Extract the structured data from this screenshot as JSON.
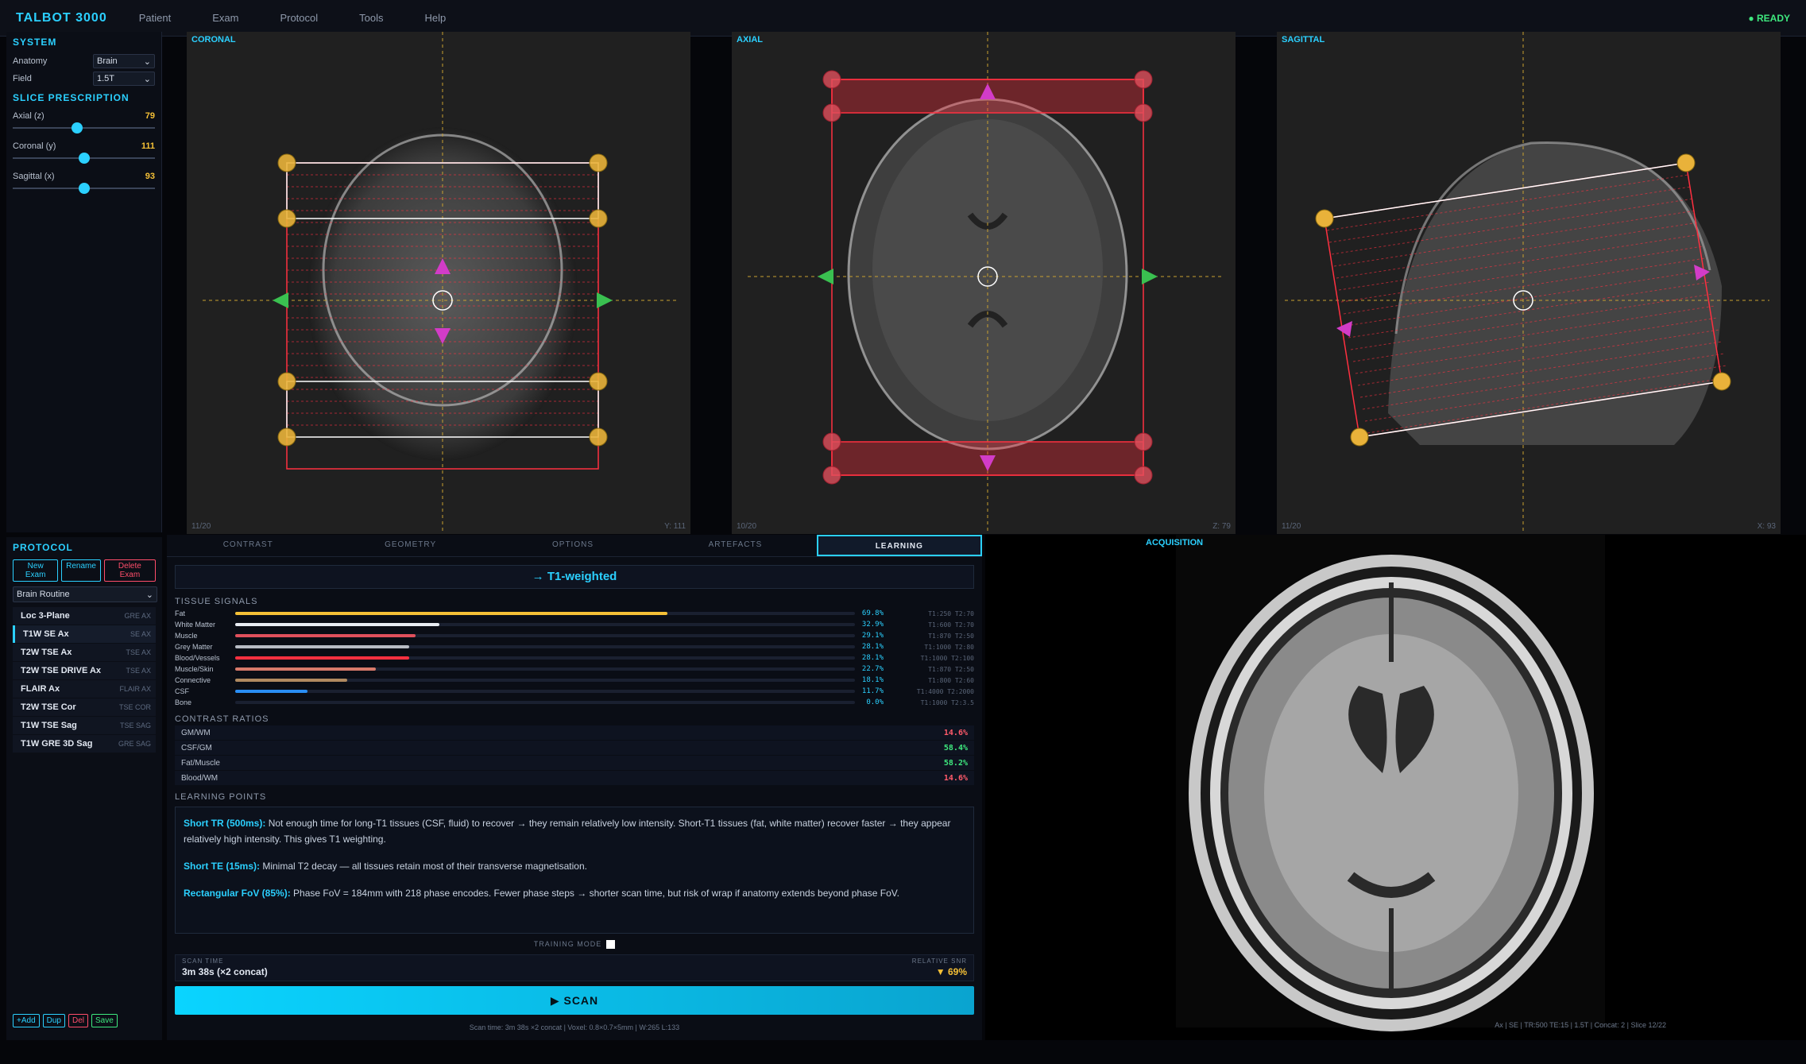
{
  "app": {
    "title": "TALBOT 3000",
    "status": "● READY"
  },
  "menu": [
    "Patient",
    "Exam",
    "Protocol",
    "Tools",
    "Help"
  ],
  "system": {
    "title": "SYSTEM",
    "anatomy_label": "Anatomy",
    "anatomy_value": "Brain",
    "field_label": "Field",
    "field_value": "1.5T"
  },
  "slice": {
    "title": "SLICE PRESCRIPTION",
    "axial_label": "Axial (z)",
    "axial_value": "79",
    "axial_frac": 0.45,
    "coronal_label": "Coronal (y)",
    "coronal_value": "111",
    "coronal_frac": 0.5,
    "sagittal_label": "Sagittal (x)",
    "sagittal_value": "93",
    "sagittal_frac": 0.5
  },
  "viewports": {
    "coronal": {
      "label": "CORONAL",
      "foot_left": "11/20",
      "foot_right": "Y: 111"
    },
    "axial": {
      "label": "AXIAL",
      "foot_left": "10/20",
      "foot_right": "Z: 79"
    },
    "sagittal": {
      "label": "SAGITTAL",
      "foot_left": "11/20",
      "foot_right": "X: 93"
    }
  },
  "protocol": {
    "title": "PROTOCOL",
    "new_exam": "New Exam",
    "rename": "Rename",
    "delete_exam": "Delete Exam",
    "routine": "Brain Routine",
    "items": [
      {
        "name": "Loc 3-Plane",
        "type": "GRE AX"
      },
      {
        "name": "T1W SE Ax",
        "type": "SE AX"
      },
      {
        "name": "T2W TSE Ax",
        "type": "TSE AX"
      },
      {
        "name": "T2W TSE DRIVE Ax",
        "type": "TSE AX"
      },
      {
        "name": "FLAIR Ax",
        "type": "FLAIR AX"
      },
      {
        "name": "T2W TSE Cor",
        "type": "TSE COR"
      },
      {
        "name": "T1W TSE Sag",
        "type": "TSE SAG"
      },
      {
        "name": "T1W GRE 3D Sag",
        "type": "GRE SAG"
      }
    ],
    "add": "+Add",
    "dup": "Dup",
    "del": "Del",
    "save": "Save"
  },
  "tabs": [
    "CONTRAST",
    "GEOMETRY",
    "OPTIONS",
    "ARTEFACTS",
    "LEARNING"
  ],
  "learning": {
    "weighting": "→ T1-weighted",
    "tissue_title": "TISSUE SIGNALS",
    "tissues": [
      {
        "name": "Fat",
        "pct": "69.8%",
        "frac": 0.698,
        "color": "#f5c036",
        "t": "T1:250 T2:70"
      },
      {
        "name": "White Matter",
        "pct": "32.9%",
        "frac": 0.329,
        "color": "#e8ecf2",
        "t": "T1:600 T2:70"
      },
      {
        "name": "Muscle",
        "pct": "29.1%",
        "frac": 0.291,
        "color": "#e0505c",
        "t": "T1:870 T2:50"
      },
      {
        "name": "Grey Matter",
        "pct": "28.1%",
        "frac": 0.281,
        "color": "#b8bcc4",
        "t": "T1:1000 T2:80"
      },
      {
        "name": "Blood/Vessels",
        "pct": "28.1%",
        "frac": 0.281,
        "color": "#ff3040",
        "t": "T1:1000 T2:100"
      },
      {
        "name": "Muscle/Skin",
        "pct": "22.7%",
        "frac": 0.227,
        "color": "#d87a6a",
        "t": "T1:870 T2:50"
      },
      {
        "name": "Connective",
        "pct": "18.1%",
        "frac": 0.181,
        "color": "#b08a60",
        "t": "T1:800 T2:60"
      },
      {
        "name": "CSF",
        "pct": "11.7%",
        "frac": 0.117,
        "color": "#2a8ef5",
        "t": "T1:4000 T2:2000"
      },
      {
        "name": "Bone",
        "pct": "0.0%",
        "frac": 0.0,
        "color": "#606878",
        "t": "T1:1000 T2:3.5"
      }
    ],
    "ratios_title": "CONTRAST RATIOS",
    "ratios": [
      {
        "name": "GM/WM",
        "value": "14.6%",
        "color": "#ff5a6a"
      },
      {
        "name": "CSF/GM",
        "value": "58.4%",
        "color": "#3ee87e"
      },
      {
        "name": "Fat/Muscle",
        "value": "58.2%",
        "color": "#3ee87e"
      },
      {
        "name": "Blood/WM",
        "value": "14.6%",
        "color": "#ff5a6a"
      }
    ],
    "points_title": "LEARNING POINTS",
    "points": [
      {
        "head": "Short TR (500ms):",
        "body": " Not enough time for long-T1 tissues (CSF, fluid) to recover → they remain relatively low intensity. Short-T1 tissues (fat, white matter) recover faster → they appear relatively high intensity. This gives T1 weighting."
      },
      {
        "head": "Short TE (15ms):",
        "body": " Minimal T2 decay — all tissues retain most of their transverse magnetisation."
      },
      {
        "head": "Rectangular FoV (85%):",
        "body": " Phase FoV = 184mm with 218 phase encodes. Fewer phase steps → shorter scan time, but risk of wrap if anatomy extends beyond phase FoV."
      }
    ]
  },
  "scan": {
    "training_mode": "TRAINING MODE",
    "time_label": "SCAN TIME",
    "time_value": "3m 38s (×2 concat)",
    "snr_label": "RELATIVE SNR",
    "snr_value": "▼ 69%",
    "button": "▶ SCAN",
    "footer": "Scan time: 3m 38s ×2 concat | Voxel: 0.8×0.7×5mm | W:265 L:133"
  },
  "acquisition": {
    "label": "ACQUISITION",
    "footer": "Ax | SE | TR:500 TE:15 | 1.5T | Concat: 2 | Slice 12/22"
  },
  "colors": {
    "accent": "#2bd0ff",
    "ok": "#3ee87e",
    "warn": "#f5c036",
    "danger": "#ff4d6a",
    "handle": "#e9b23a",
    "magenta": "#d23cc8"
  }
}
